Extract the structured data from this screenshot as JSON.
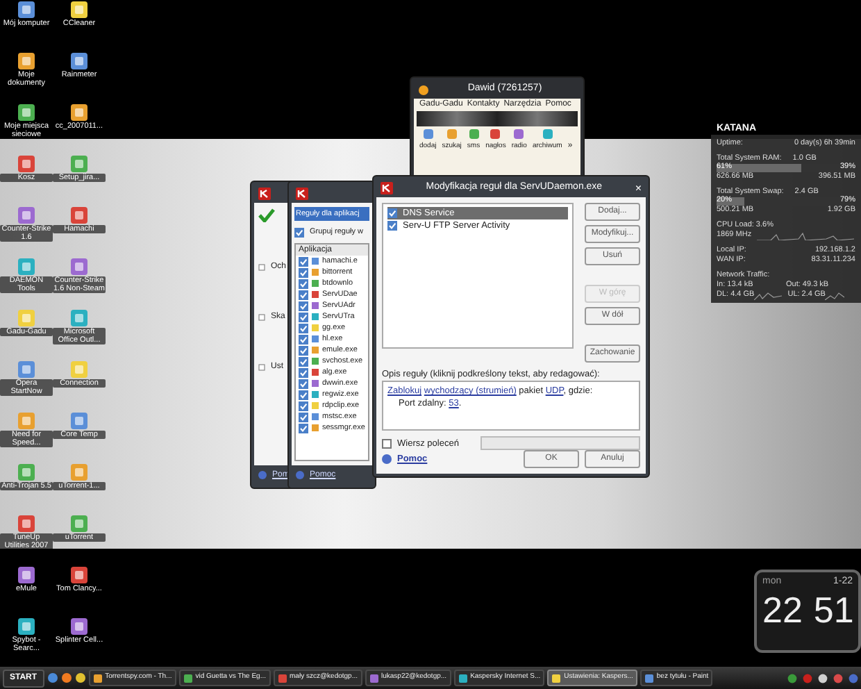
{
  "desktop_icons": [
    {
      "label": "Mój komputer"
    },
    {
      "label": "Moje dokumenty"
    },
    {
      "label": "Moje miejsca sieciowe"
    },
    {
      "label": "Kosz"
    },
    {
      "label": "Counter-Strike 1.6"
    },
    {
      "label": "DAEMON Tools"
    },
    {
      "label": "Gadu-Gadu"
    },
    {
      "label": "Opera StartNow"
    },
    {
      "label": "Need for Speed..."
    },
    {
      "label": "Anti-Trojan 5.5"
    },
    {
      "label": "TuneUp Utilities 2007"
    },
    {
      "label": "eMule"
    },
    {
      "label": "Spybot - Searc..."
    },
    {
      "label": "CCleaner"
    },
    {
      "label": "Rainmeter"
    },
    {
      "label": "cc_2007011..."
    },
    {
      "label": "Setup_jira..."
    },
    {
      "label": "Hamachi"
    },
    {
      "label": "Counter-Strike 1.6 Non-Steam"
    },
    {
      "label": "Microsoft Office Outl..."
    },
    {
      "label": "Connection"
    },
    {
      "label": "Core Temp"
    },
    {
      "label": "uTorrent-1..."
    },
    {
      "label": "uTorrent"
    },
    {
      "label": "Tom Clancy..."
    },
    {
      "label": "Splinter Cell..."
    }
  ],
  "gadu_window": {
    "title": "Dawid (7261257)",
    "menu": [
      "Gadu-Gadu",
      "Kontakty",
      "Narzędzia",
      "Pomoc"
    ],
    "toolbar": [
      "dodaj",
      "szukaj",
      "sms",
      "nagłos",
      "radio",
      "archiwum"
    ],
    "more": "»"
  },
  "settings_window": {
    "tree": [
      "Och",
      "Ska",
      "Ust"
    ],
    "help": "Pom"
  },
  "rules_window": {
    "tab": "Reguły dla aplikacj",
    "group_checkbox": {
      "label": "Grupuj reguły w",
      "checked": true
    },
    "column": "Aplikacja",
    "apps": [
      {
        "name": "hamachi.e",
        "checked": true
      },
      {
        "name": "bittorrent",
        "checked": true
      },
      {
        "name": "btdownlo",
        "checked": true
      },
      {
        "name": "ServUDae",
        "checked": true
      },
      {
        "name": "ServUAdr",
        "checked": true
      },
      {
        "name": "ServUTra",
        "checked": true
      },
      {
        "name": "gg.exe",
        "checked": true
      },
      {
        "name": "hl.exe",
        "checked": true
      },
      {
        "name": "emule.exe",
        "checked": true
      },
      {
        "name": "svchost.exe",
        "checked": true
      },
      {
        "name": "alg.exe",
        "checked": true
      },
      {
        "name": "dwwin.exe",
        "checked": true
      },
      {
        "name": "regwiz.exe",
        "checked": true
      },
      {
        "name": "rdpclip.exe",
        "checked": true
      },
      {
        "name": "mstsc.exe",
        "checked": true
      },
      {
        "name": "sessmgr.exe",
        "checked": true
      }
    ],
    "help": "Pomoc"
  },
  "rule_dialog": {
    "title": "Modyfikacja reguł dla ServUDaemon.exe",
    "rules": [
      {
        "name": "DNS Service",
        "checked": true,
        "selected": true
      },
      {
        "name": "Serv-U FTP Server Activity",
        "checked": true,
        "selected": false
      }
    ],
    "button_groups": [
      [
        {
          "label": "Dodaj...",
          "disabled": false
        },
        {
          "label": "Modyfikuj...",
          "disabled": false
        },
        {
          "label": "Usuń",
          "disabled": false
        }
      ],
      [
        {
          "label": "W górę",
          "disabled": true
        },
        {
          "label": "W dół",
          "disabled": false
        }
      ],
      [
        {
          "label": "Zachowanie",
          "disabled": false
        }
      ]
    ],
    "description_label": "Opis reguły (kliknij podkreślony tekst, aby redagować):",
    "close": "×",
    "description": [
      [
        {
          "text": "Zablokuj",
          "link": true
        },
        {
          "text": "wychodzący (strumień)",
          "link": true
        },
        {
          "text": " pakiet ",
          "link": false
        },
        {
          "text": "UDP",
          "link": true
        },
        {
          "text": ", gdzie:",
          "link": false
        }
      ],
      [
        {
          "text": "Port zdalny: ",
          "link": false
        },
        {
          "text": "53",
          "link": true
        },
        {
          "text": ".",
          "link": false
        }
      ]
    ],
    "command_line": {
      "label": "Wiersz poleceń",
      "checked": false,
      "disabled": true
    },
    "help": "Pomoc",
    "ok": "OK",
    "cancel": "Anuluj"
  },
  "system_monitor": {
    "title": "KATANA",
    "uptime": {
      "label": "Uptime:",
      "value": "0 day(s) 6h 39min"
    },
    "ram": {
      "label": "Total System RAM:",
      "total": "1.0 GB",
      "used_pct": "61%",
      "free_pct": "39%",
      "level": 0.61,
      "used": "626.66 MB",
      "free": "396.51 MB"
    },
    "swap": {
      "label": "Total System Swap:",
      "total": "2.4 GB",
      "used_pct": "20%",
      "free_pct": "79%",
      "level": 0.2,
      "used": "500.21 MB",
      "free": "1.92 GB"
    },
    "cpu": {
      "load": "CPU Load: 3.6%",
      "clock": "1869 MHz"
    },
    "local_ip": {
      "label": "Local IP:",
      "value": "192.168.1.2"
    },
    "wan_ip": {
      "label": "WAN IP:",
      "value": "83.31.11.234"
    },
    "network": {
      "label": "Network Traffic:",
      "in": "In: 13.4 kB",
      "out": "Out: 49.3 kB",
      "dl": "DL: 4.4 GB",
      "ul": "UL: 2.4 GB"
    }
  },
  "clock": {
    "day": "mon",
    "date": "1-22",
    "hours": "22",
    "minutes": "51"
  },
  "taskbar": {
    "start": "START",
    "tasks": [
      {
        "label": "Torrentspy.com - Th...",
        "selected": false
      },
      {
        "label": "vid Guetta vs The Eg...",
        "selected": false
      },
      {
        "label": "mały szcz@kedotgp...",
        "selected": false
      },
      {
        "label": "lukasp22@kedotgp...",
        "selected": false
      },
      {
        "label": "Kaspersky Internet S...",
        "selected": false
      },
      {
        "label": "Ustawienia: Kaspers...",
        "selected": true
      },
      {
        "label": "bez tytułu - Paint",
        "selected": false
      }
    ]
  }
}
